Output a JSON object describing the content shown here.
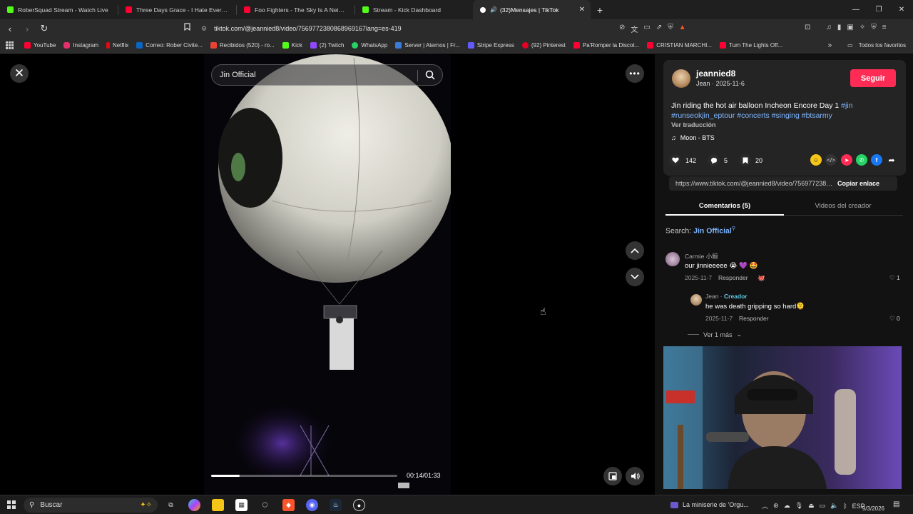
{
  "browser": {
    "tabs": [
      {
        "title": "RoberSquad Stream - Watch Live",
        "favicon_color": "#53fc18"
      },
      {
        "title": "Three Days Grace - I Hate Everything",
        "favicon_color": "#ff0033"
      },
      {
        "title": "Foo Fighters - The Sky Is A Neighbo",
        "favicon_color": "#ff0033"
      },
      {
        "title": "Stream - Kick Dashboard",
        "favicon_color": "#53fc18"
      },
      {
        "title": "(32)Mensajes | TikTok",
        "favicon_color": "#ffffff",
        "active": true
      }
    ],
    "url": "tiktok.com/@jeannied8/video/7569772380868969167lang=es-419",
    "bookmarks": [
      {
        "label": "YouTube",
        "color": "#ff0033"
      },
      {
        "label": "Instagram",
        "color": "#e1306c"
      },
      {
        "label": "Netflix",
        "color": "#e50914"
      },
      {
        "label": "Correo: Rober Civite...",
        "color": "#0a66c2"
      },
      {
        "label": "Recibidos (520) - ro...",
        "color": "#ea4335"
      },
      {
        "label": "Kick",
        "color": "#53fc18"
      },
      {
        "label": "(2) Twitch",
        "color": "#9146ff"
      },
      {
        "label": "WhatsApp",
        "color": "#25d366"
      },
      {
        "label": "Server | Aternos | Fr...",
        "color": "#3a7bd5"
      },
      {
        "label": "Stripe Express",
        "color": "#635bff"
      },
      {
        "label": "(92) Pinterest",
        "color": "#e60023"
      },
      {
        "label": "Pa'Romper la Discot...",
        "color": "#ff0033"
      },
      {
        "label": "CRISTIAN MARCHI...",
        "color": "#ff0033"
      },
      {
        "label": "Turn The Lights Off...",
        "color": "#ff0033"
      }
    ],
    "all_bookmarks_label": "Todos los favoritos"
  },
  "video": {
    "search_text": "Jin Official",
    "time": "00:14/01:33",
    "progress": 0.155
  },
  "post": {
    "username": "jeannied8",
    "subline": "Jean · 2025-11-6",
    "follow_label": "Seguir",
    "desc_text": "Jin riding the hot air balloon Incheon Encore Day 1 ",
    "tags": [
      "#jin",
      "#runseokjin_eptour",
      "#concerts",
      "#singing",
      "#btsarmy"
    ],
    "translate_label": "Ver traducción",
    "music": "Moon - BTS",
    "likes": "142",
    "comments": "5",
    "saves": "20",
    "link": "https://www.tiktok.com/@jeannied8/video/7569772380868969167",
    "copy_label": "Copiar enlace"
  },
  "tabs": {
    "comments_label": "Comentarios (5)",
    "creator_videos_label": "Videos del creador"
  },
  "search_hint": {
    "prefix": "Search: ",
    "term": "Jin Official"
  },
  "comments": [
    {
      "name": "Carmie 小鲸",
      "text": "our jinnieeeee 😭 💜 🤩",
      "date": "2025-11-7",
      "reply_label": "Responder",
      "likes": "1"
    },
    {
      "name": "Jean",
      "creator_badge": "Creador",
      "text": "he was death gripping so hard🫠",
      "date": "2025-11-7",
      "reply_label": "Responder",
      "likes": "0"
    }
  ],
  "view_more_label": "Ver 1 más",
  "taskbar": {
    "search_placeholder": "Buscar",
    "media_title": "La miniserie de 'Orgu...",
    "language": "ESP",
    "time": "",
    "date": "9/3/2026"
  }
}
